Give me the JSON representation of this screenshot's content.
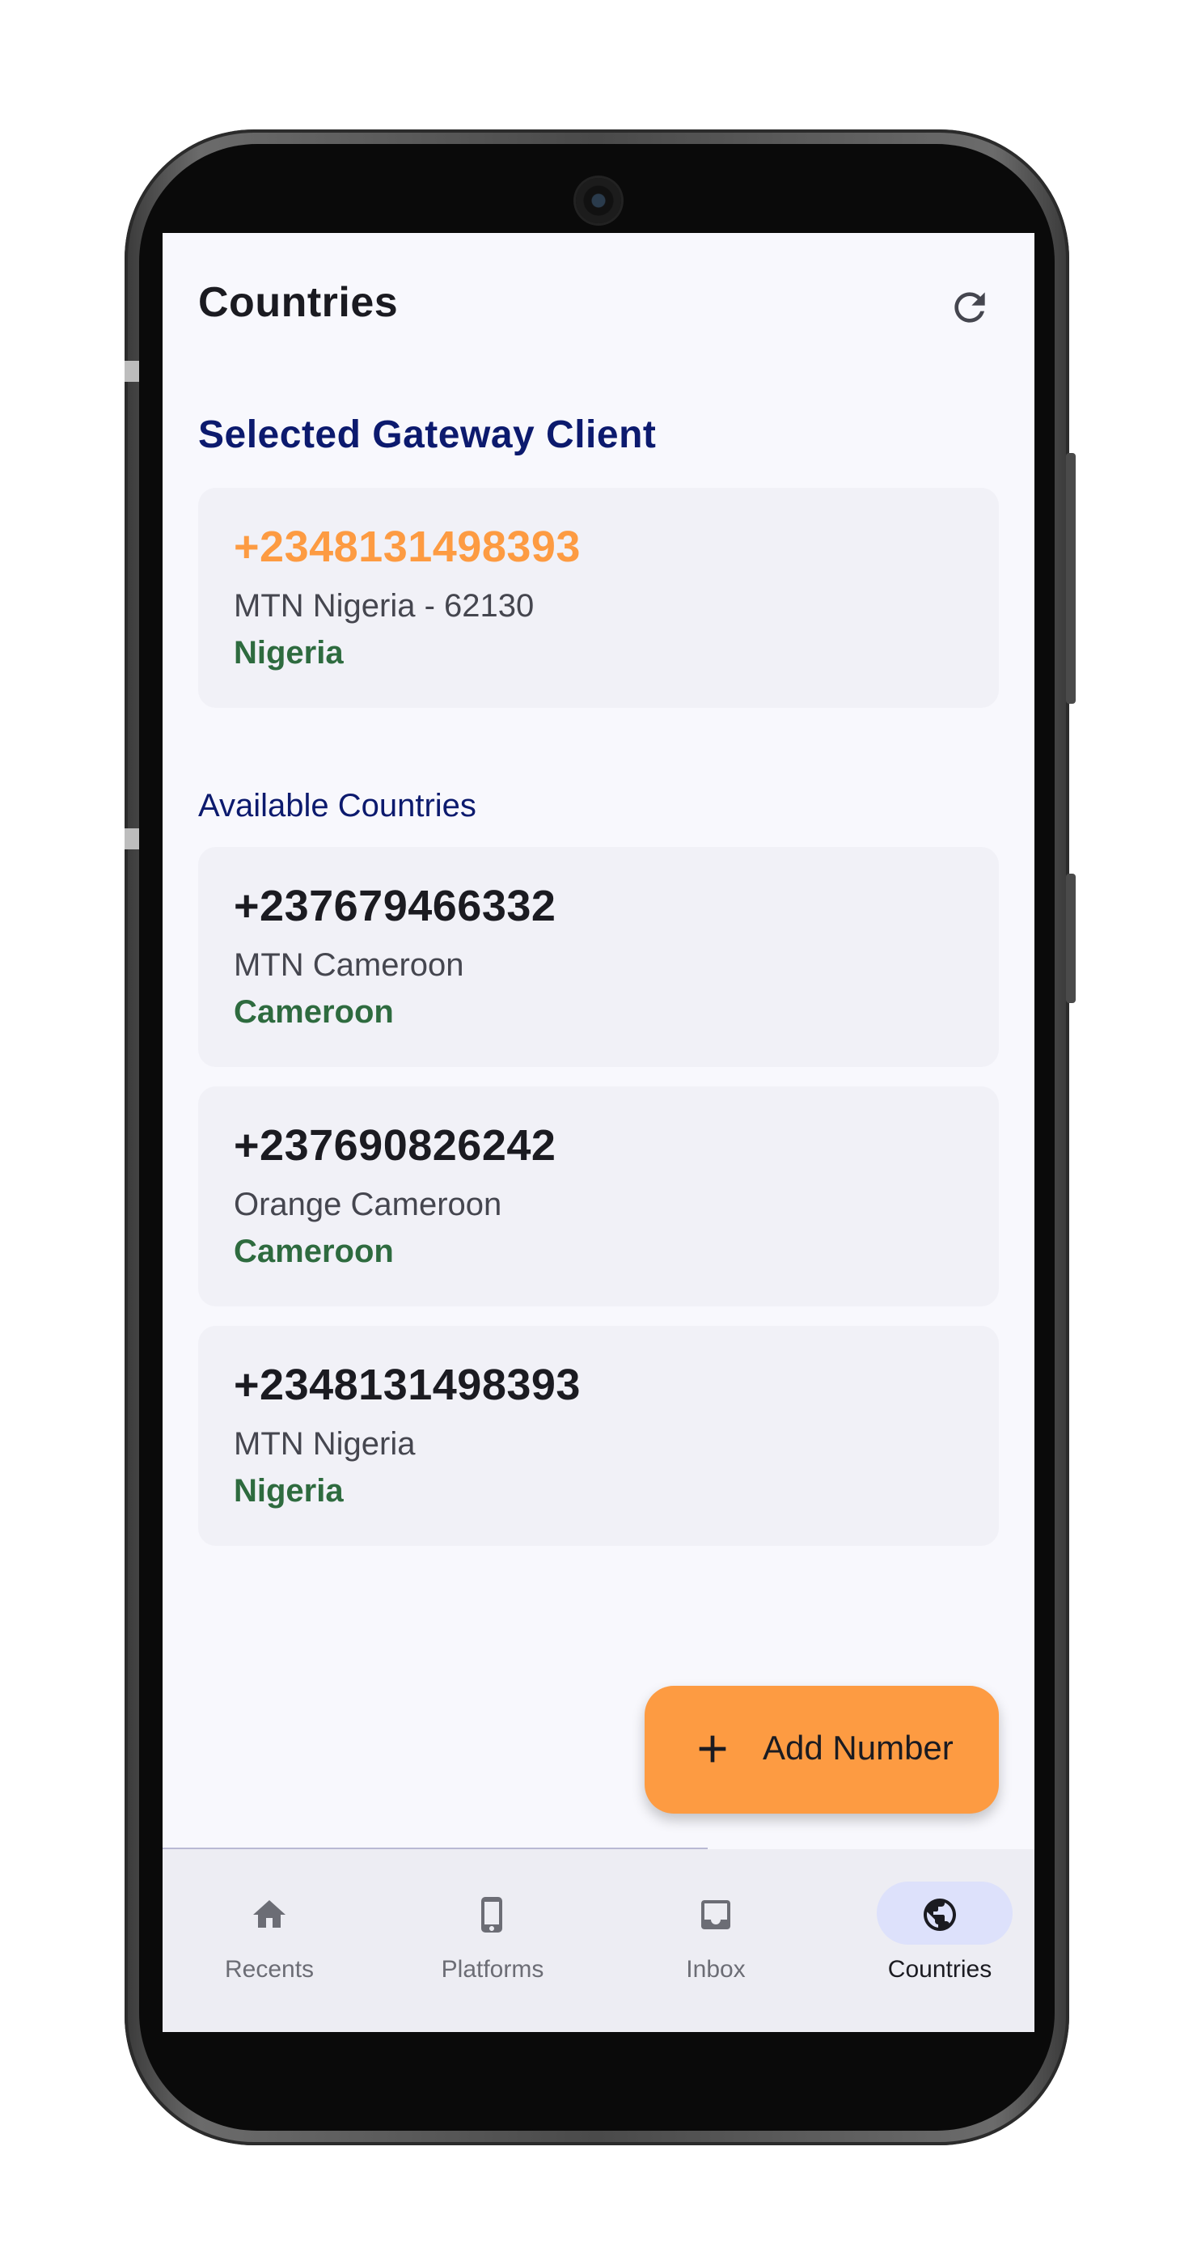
{
  "header": {
    "title": "Countries",
    "refresh_icon": "refresh-icon"
  },
  "selected_section": {
    "heading": "Selected Gateway Client",
    "card": {
      "number": "+2348131498393",
      "operator": "MTN Nigeria - 62130",
      "country": "Nigeria"
    }
  },
  "available_section": {
    "label": "Available Countries",
    "items": [
      {
        "number": "+237679466332",
        "operator": "MTN Cameroon",
        "country": "Cameroon"
      },
      {
        "number": "+237690826242",
        "operator": "Orange Cameroon",
        "country": "Cameroon"
      },
      {
        "number": "+2348131498393",
        "operator": "MTN Nigeria",
        "country": "Nigeria"
      }
    ]
  },
  "fab": {
    "label": "Add Number",
    "icon": "plus-icon"
  },
  "navbar": {
    "items": [
      {
        "label": "Recents",
        "icon": "home-icon",
        "active": false
      },
      {
        "label": "Platforms",
        "icon": "phone-icon",
        "active": false
      },
      {
        "label": "Inbox",
        "icon": "inbox-icon",
        "active": false
      },
      {
        "label": "Countries",
        "icon": "globe-icon",
        "active": true
      }
    ]
  },
  "colors": {
    "accent_orange": "#fd9b42",
    "heading_navy": "#0c1a6e",
    "country_green": "#2e6b3f",
    "active_nav_pill": "#dde1fb",
    "screen_background": "#f8f8fd",
    "card_background": "#f1f1f7"
  }
}
